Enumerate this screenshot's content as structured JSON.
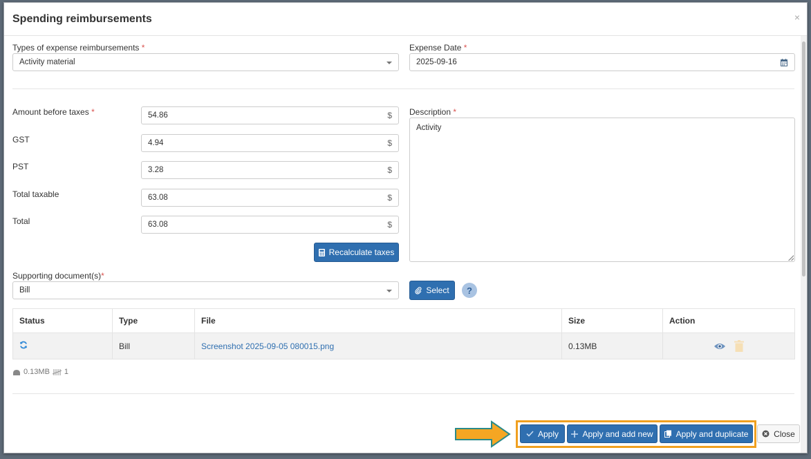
{
  "modal": {
    "title": "Spending reimbursements",
    "close_symbol": "×"
  },
  "form": {
    "expense_type": {
      "label": "Types of expense reimbursements",
      "required": "*",
      "value": "Activity material"
    },
    "expense_date": {
      "label": "Expense Date",
      "required": "*",
      "value": "2025-09-16"
    },
    "amount_before_taxes": {
      "label": "Amount before taxes",
      "required": "*",
      "value": "54.86",
      "suffix": "$"
    },
    "gst": {
      "label": "GST",
      "value": "4.94",
      "suffix": "$"
    },
    "pst": {
      "label": "PST",
      "value": "3.28",
      "suffix": "$"
    },
    "total_taxable": {
      "label": "Total taxable",
      "value": "63.08",
      "suffix": "$"
    },
    "total": {
      "label": "Total",
      "value": "63.08",
      "suffix": "$"
    },
    "recalculate_label": "Recalculate taxes",
    "description": {
      "label": "Description",
      "required": "*",
      "value": "Activity"
    },
    "supporting_docs": {
      "label": "Supporting document(s)",
      "required": "*",
      "value": "Bill"
    },
    "select_label": "Select",
    "help_symbol": "?"
  },
  "documents_table": {
    "headers": [
      "Status",
      "Type",
      "File",
      "Size",
      "Action"
    ],
    "rows": [
      {
        "status_icon": "sync-icon",
        "type": "Bill",
        "file": "Screenshot 2025-09-05 080015.png",
        "size": "0.13MB"
      }
    ]
  },
  "summary": {
    "total_size": "0.13MB",
    "count": "1"
  },
  "footer": {
    "apply_label": "Apply",
    "apply_new_label": "Apply and add new",
    "apply_duplicate_label": "Apply and duplicate",
    "close_label": "Close"
  },
  "colors": {
    "primary": "#2f6fb0",
    "highlight": "#f0a020",
    "arrow_fill": "#f5a623",
    "arrow_stroke": "#2a8a8a"
  }
}
